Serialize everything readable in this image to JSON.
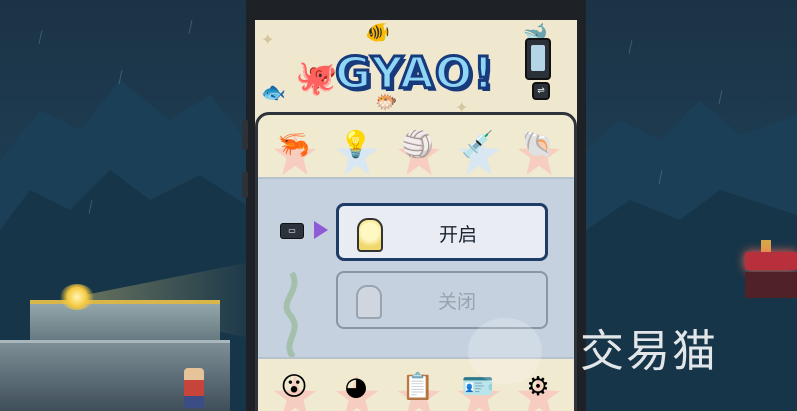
{
  "game": {
    "logo_text": "GYAO!",
    "header_buttons": [
      {
        "name": "document-icon",
        "glyph": ""
      },
      {
        "name": "swap-icon",
        "glyph": "⇌"
      }
    ]
  },
  "tabs_top": [
    {
      "name": "tab-shrimp",
      "glyph": "🦐",
      "selected": false
    },
    {
      "name": "tab-lightbulb",
      "glyph": "💡",
      "selected": true
    },
    {
      "name": "tab-beachball",
      "glyph": "🏐",
      "selected": false
    },
    {
      "name": "tab-syringe",
      "glyph": "💉",
      "selected": false
    },
    {
      "name": "tab-snail",
      "glyph": "🐚",
      "selected": false
    }
  ],
  "options": {
    "on_label": "开启",
    "off_label": "关闭",
    "selected": "on"
  },
  "key_hint": "▭",
  "tabs_bottom": [
    {
      "name": "tab-face",
      "glyph": "😮"
    },
    {
      "name": "tab-pacman",
      "glyph": "◕"
    },
    {
      "name": "tab-clipboard",
      "glyph": "📋"
    },
    {
      "name": "tab-id-card",
      "glyph": "🪪"
    },
    {
      "name": "tab-settings",
      "glyph": "⚙"
    }
  ],
  "watermark": "交易猫",
  "colors": {
    "logo_fill": "#8fd5f5",
    "logo_outline": "#173a7d",
    "selected_border": "#1d3c66",
    "cursor": "#8e5ad6",
    "star": "#f6cdbf"
  }
}
